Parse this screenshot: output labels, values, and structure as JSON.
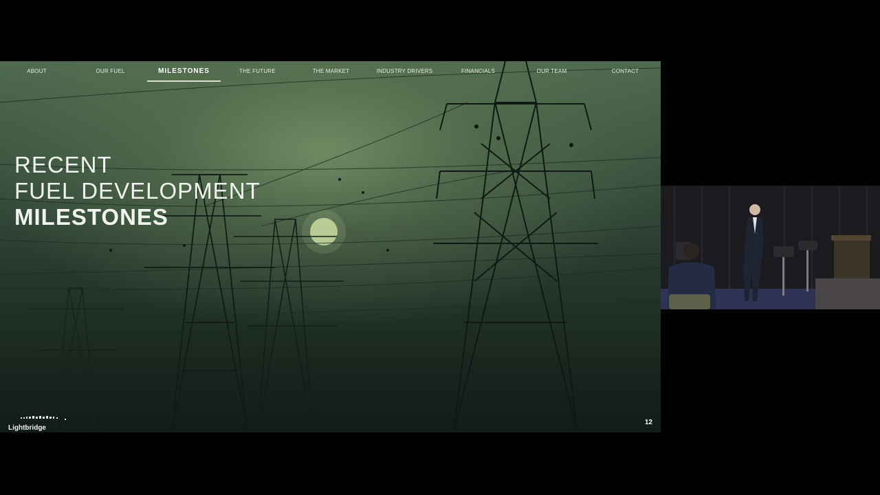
{
  "slide": {
    "nav": [
      {
        "label": "ABOUT",
        "active": false
      },
      {
        "label": "OUR FUEL",
        "active": false
      },
      {
        "label": "MILESTONES",
        "active": true
      },
      {
        "label": "THE FUTURE",
        "active": false
      },
      {
        "label": "THE MARKET",
        "active": false
      },
      {
        "label": "INDUSTRY DRIVERS",
        "active": false
      },
      {
        "label": "FINANCIALS",
        "active": false
      },
      {
        "label": "OUR TEAM",
        "active": false
      },
      {
        "label": "CONTACT",
        "active": false
      }
    ],
    "headline": {
      "line1": "RECENT",
      "line2": "FUEL DEVELOPMENT",
      "line3": "MILESTONES"
    },
    "logo_text": "Lightbridge",
    "page_number": "12"
  },
  "colors": {
    "background": "#000000",
    "slide_tint": "#3b5541",
    "text": "#f0f3ee"
  }
}
